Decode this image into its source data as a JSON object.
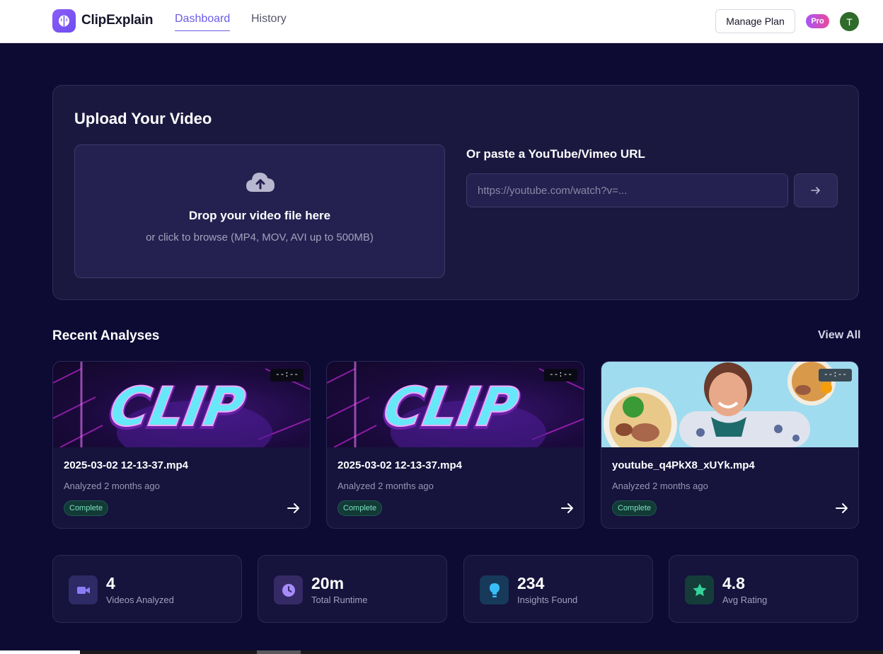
{
  "header": {
    "brand": "ClipExplain",
    "nav": [
      {
        "label": "Dashboard",
        "active": true
      },
      {
        "label": "History",
        "active": false
      }
    ],
    "manage_plan": "Manage Plan",
    "plan_badge": "Pro",
    "avatar_initial": "T",
    "accent": "#6b5ce7"
  },
  "upload": {
    "title": "Upload Your Video",
    "drop_title": "Drop your video file here",
    "drop_sub": "or click to browse (MP4, MOV, AVI up to 500MB)",
    "url_label": "Or paste a YouTube/Vimeo URL",
    "url_placeholder": "https://youtube.com/watch?v=...",
    "url_value": "",
    "cloud_icon": "cloud-upload-icon",
    "submit_icon": "arrow-right-icon"
  },
  "recent": {
    "title": "Recent Analyses",
    "view_all": "View All",
    "items": [
      {
        "title": "2025-03-02 12-13-37.mp4",
        "meta": "Analyzed 2 months ago",
        "status": "Complete",
        "duration": "--:--",
        "thumb_text": "CLIP"
      },
      {
        "title": "2025-03-02 12-13-37.mp4",
        "meta": "Analyzed 2 months ago",
        "status": "Complete",
        "duration": "--:--",
        "thumb_text": "CLIP"
      },
      {
        "title": "youtube_q4PkX8_xUYk.mp4",
        "meta": "Analyzed 2 months ago",
        "status": "Complete",
        "duration": "--:--",
        "thumb_text": ""
      }
    ]
  },
  "stats": [
    {
      "value": "4",
      "label": "Videos Analyzed",
      "icon": "video-camera-icon",
      "color": "#8b7cf6"
    },
    {
      "value": "20m",
      "label": "Total Runtime",
      "icon": "clock-icon",
      "color": "#a78bfa"
    },
    {
      "value": "234",
      "label": "Insights Found",
      "icon": "lightbulb-icon",
      "color": "#38bdf8"
    },
    {
      "value": "4.8",
      "label": "Avg Rating",
      "icon": "star-icon",
      "color": "#34d399"
    }
  ]
}
